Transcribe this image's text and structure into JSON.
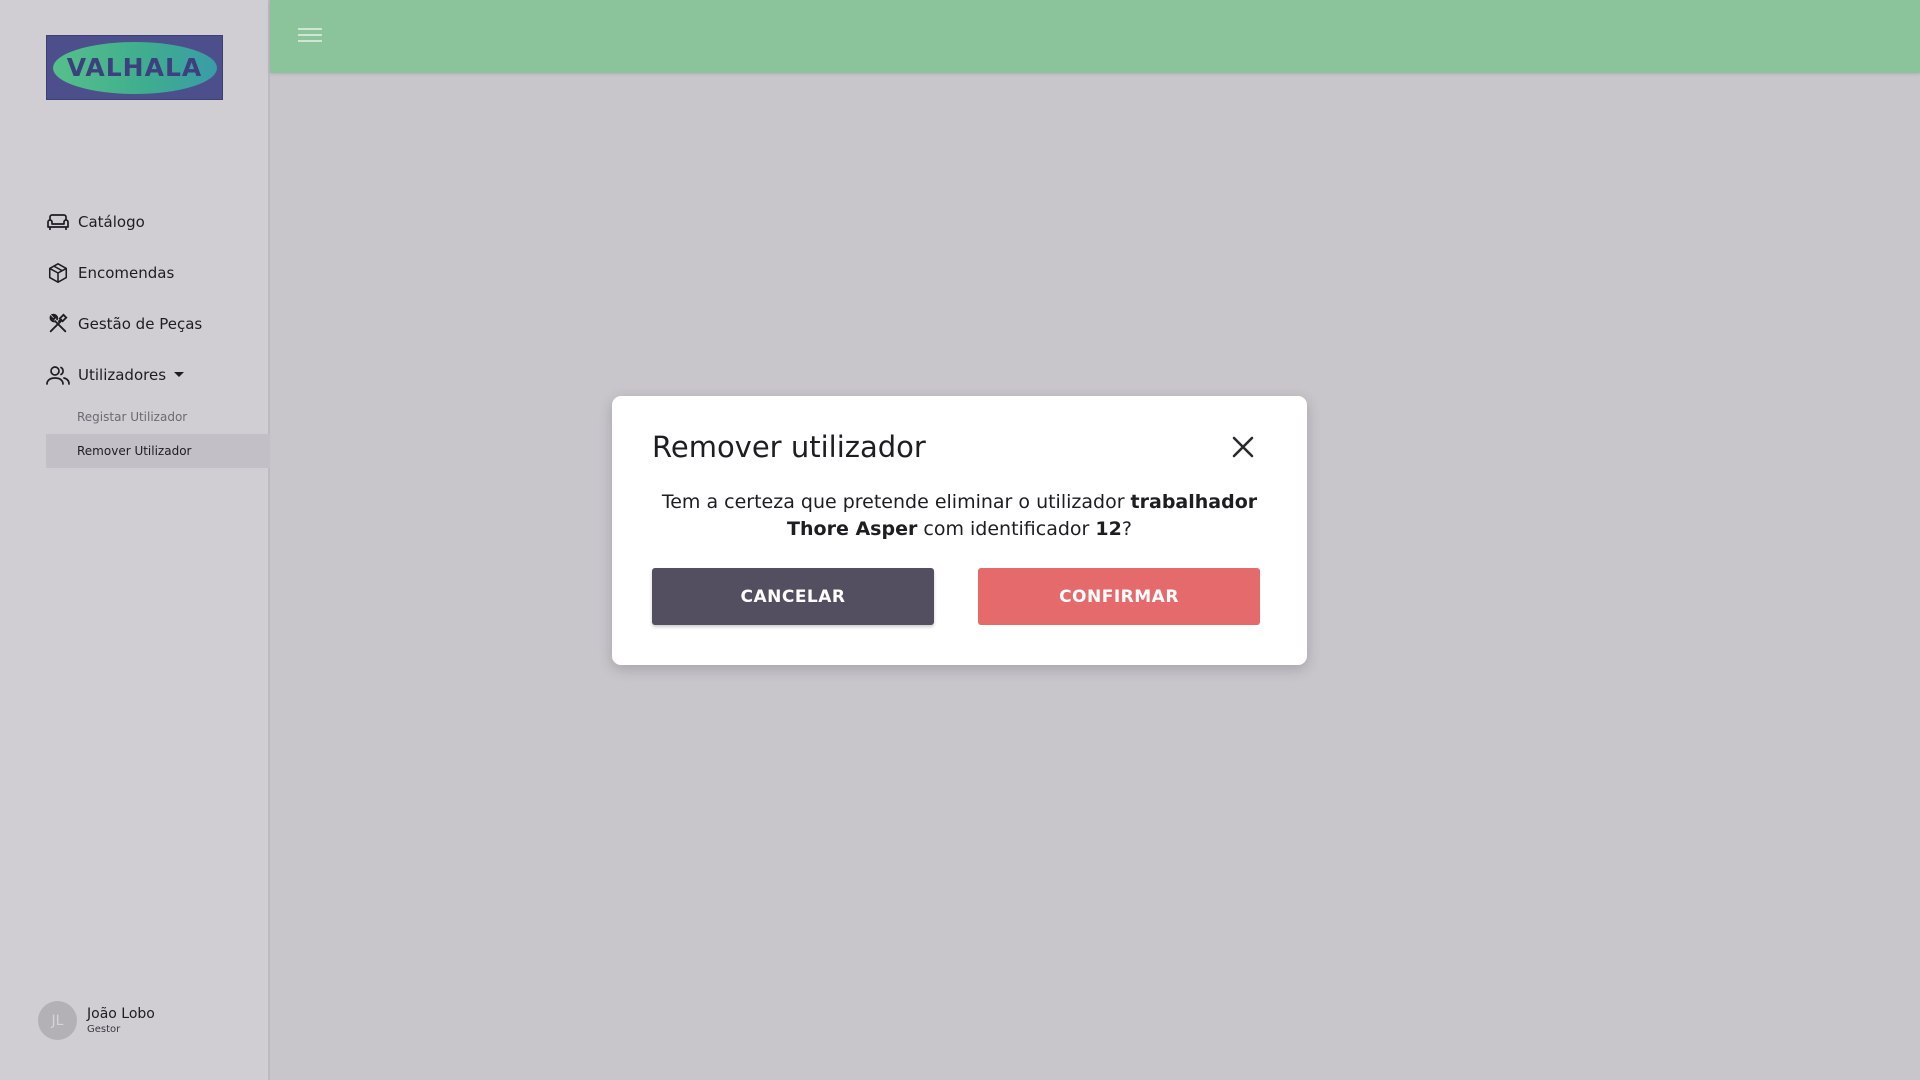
{
  "logo": {
    "text": "VALHALA"
  },
  "sidebar": {
    "items": [
      {
        "label": "Catálogo",
        "icon": "sofa-icon"
      },
      {
        "label": "Encomendas",
        "icon": "package-icon"
      },
      {
        "label": "Gestão de Peças",
        "icon": "tools-icon"
      },
      {
        "label": "Utilizadores",
        "icon": "users-icon"
      }
    ],
    "subitems": [
      {
        "label": "Registar Utilizador",
        "active": false
      },
      {
        "label": "Remover Utilizador",
        "active": true
      }
    ]
  },
  "user": {
    "initials": "JL",
    "name": "João Lobo",
    "role": "Gestor"
  },
  "modal": {
    "title": "Remover utilizador",
    "msg_prefix": "Tem a certeza que pretende eliminar o utilizador ",
    "user_label": "trabalhador Thore Asper",
    "msg_middle": " com identificador ",
    "user_id": "12",
    "msg_suffix": "?",
    "cancel_label": "CANCELAR",
    "confirm_label": "CONFIRMAR"
  },
  "colors": {
    "topbar": "#8bc39a",
    "sidebar": "#d0ced3",
    "background": "#c8c6cb",
    "cancel": "#544f60",
    "confirm": "#e46a6b"
  }
}
